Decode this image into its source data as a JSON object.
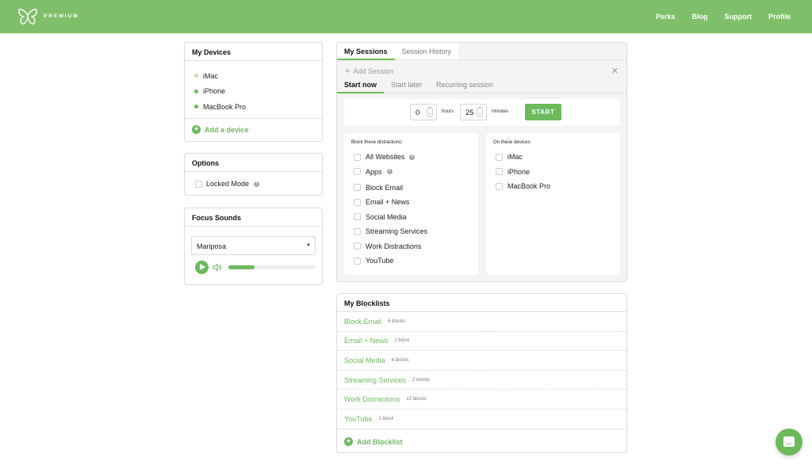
{
  "header": {
    "brand": "PREMIUM",
    "nav": [
      "Perks",
      "Blog",
      "Support",
      "Profile"
    ],
    "accent_color": "#80bf6a"
  },
  "devices_card": {
    "title": "My Devices",
    "devices": [
      {
        "name": "iMac",
        "status": "inactive"
      },
      {
        "name": "iPhone",
        "status": "active"
      },
      {
        "name": "MacBook Pro",
        "status": "active"
      }
    ],
    "add_label": "Add a device"
  },
  "options_card": {
    "title": "Options",
    "locked_mode_label": "Locked Mode",
    "locked_mode_checked": false
  },
  "sounds_card": {
    "title": "Focus Sounds",
    "selected_sound": "Mariposa",
    "volume_percent": 30
  },
  "sessions": {
    "tabs": [
      "My Sessions",
      "Session History"
    ],
    "active_tab": "My Sessions",
    "add_session_label": "Add Session",
    "subtabs": [
      "Start now",
      "Start later",
      "Recurring session"
    ],
    "active_subtab": "Start now",
    "hours_value": "0",
    "hours_label": "hours",
    "minutes_value": "25",
    "minutes_label": "minutes",
    "start_label": "START",
    "distractions_title": "Block these distractions:",
    "distractions": [
      {
        "label": "All Websites",
        "help": true
      },
      {
        "label": "Apps",
        "help": true
      },
      {
        "label": "Block Email",
        "help": false
      },
      {
        "label": "Email + News",
        "help": false
      },
      {
        "label": "Social Media",
        "help": false
      },
      {
        "label": "Streaming Services",
        "help": false
      },
      {
        "label": "Work Distractions",
        "help": false
      },
      {
        "label": "YouTube",
        "help": false
      }
    ],
    "devices_title": "On these devices:",
    "devices": [
      "iMac",
      "iPhone",
      "MacBook Pro"
    ]
  },
  "blocklists": {
    "title": "My Blocklists",
    "items": [
      {
        "name": "Block Email",
        "count": "6 blocks"
      },
      {
        "name": "Email + News",
        "count": "1 block"
      },
      {
        "name": "Social Media",
        "count": "4 blocks"
      },
      {
        "name": "Streaming Services",
        "count": "2 blocks"
      },
      {
        "name": "Work Distractions",
        "count": "12 blocks"
      },
      {
        "name": "YouTube",
        "count": "1 block"
      }
    ],
    "add_label": "Add Blocklist"
  },
  "icons": {
    "logo": "butterfly-icon",
    "chat": "chat-icon",
    "help": "question-icon"
  }
}
